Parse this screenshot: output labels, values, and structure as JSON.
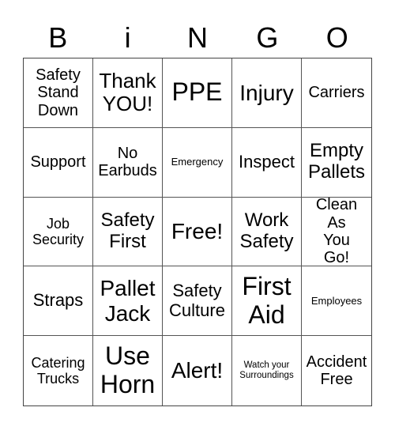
{
  "header": [
    "B",
    "i",
    "N",
    "G",
    "O"
  ],
  "cells": [
    "Safety Stand Down",
    "Thank YOU!",
    "PPE",
    "Injury",
    "Carriers",
    "Support",
    "No Earbuds",
    "Emergency",
    "Inspect",
    "Empty Pallets",
    "Job Security",
    "Safety First",
    "Free!",
    "Work Safety",
    "Clean As You Go!",
    "Straps",
    "Pallet Jack",
    "Safety Culture",
    "First Aid",
    "Employees",
    "Catering Trucks",
    "Use Horn",
    "Alert!",
    "Watch your Surroundings",
    "Accident Free"
  ]
}
